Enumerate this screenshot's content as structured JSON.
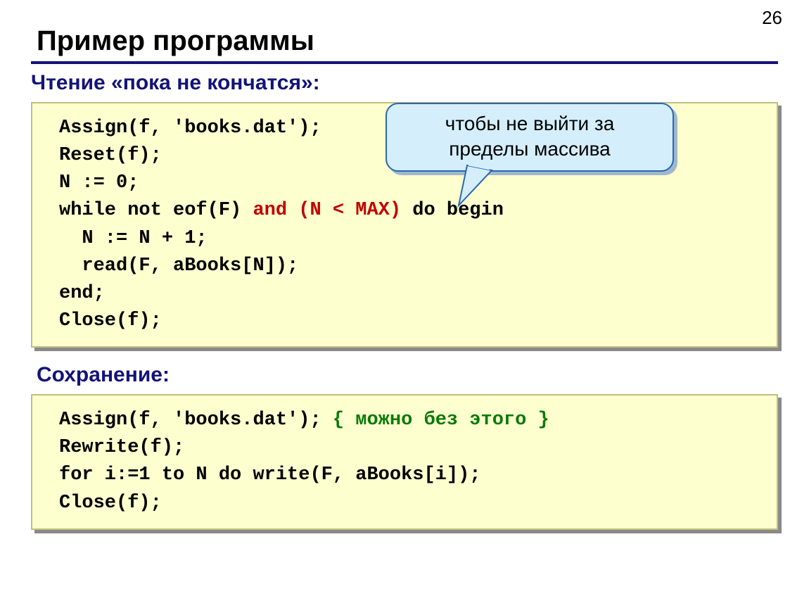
{
  "page_number": "26",
  "title": "Пример программы",
  "section1_heading": "Чтение «пока не кончатся»:",
  "section2_heading": "Сохранение:",
  "callout": {
    "line1": "чтобы не выйти за",
    "line2": "пределы массива"
  },
  "code1": {
    "l1": "Assign(f, 'books.dat');",
    "l2": "Reset(f);",
    "l3": "N := 0;",
    "l4a": "while not eof(F) ",
    "l4b_hl": "and (N < MAX)",
    "l4c": " do begin",
    "l5": "  N := N + 1;",
    "l6": "  read(F, aBooks[N]);",
    "l7": "end;",
    "l8": "Close(f);"
  },
  "code2": {
    "l1a": "Assign(f, 'books.dat'); ",
    "l1b_hl": "{ можно без этого }",
    "l2": "Rewrite(f);",
    "l3": "for i:=1 to N do write(F, aBooks[i]);",
    "l4": "Close(f);"
  }
}
